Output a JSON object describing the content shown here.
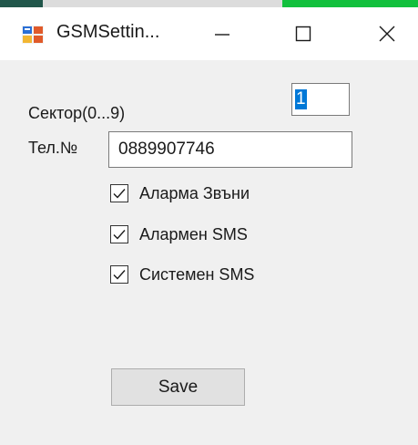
{
  "window": {
    "title": "GSMSettin...",
    "icon": "app-window-icon",
    "controls": {
      "minimize": "minimize-icon",
      "maximize": "maximize-icon",
      "close": "close-icon"
    }
  },
  "form": {
    "sector_label": "Сектор(0...9)",
    "sector_value": "1",
    "phone_label": "Тел.№",
    "phone_value": "0889907746",
    "checkboxes": [
      {
        "label": "Аларма Звъни",
        "checked": true
      },
      {
        "label": "Алармен SMS",
        "checked": true
      },
      {
        "label": "Системен SMS",
        "checked": true
      }
    ],
    "save_label": "Save"
  },
  "colors": {
    "window_bg": "#f0f0f0",
    "titlebar_bg": "#ffffff",
    "selection": "#0078d7",
    "button_bg": "#e1e1e1"
  }
}
